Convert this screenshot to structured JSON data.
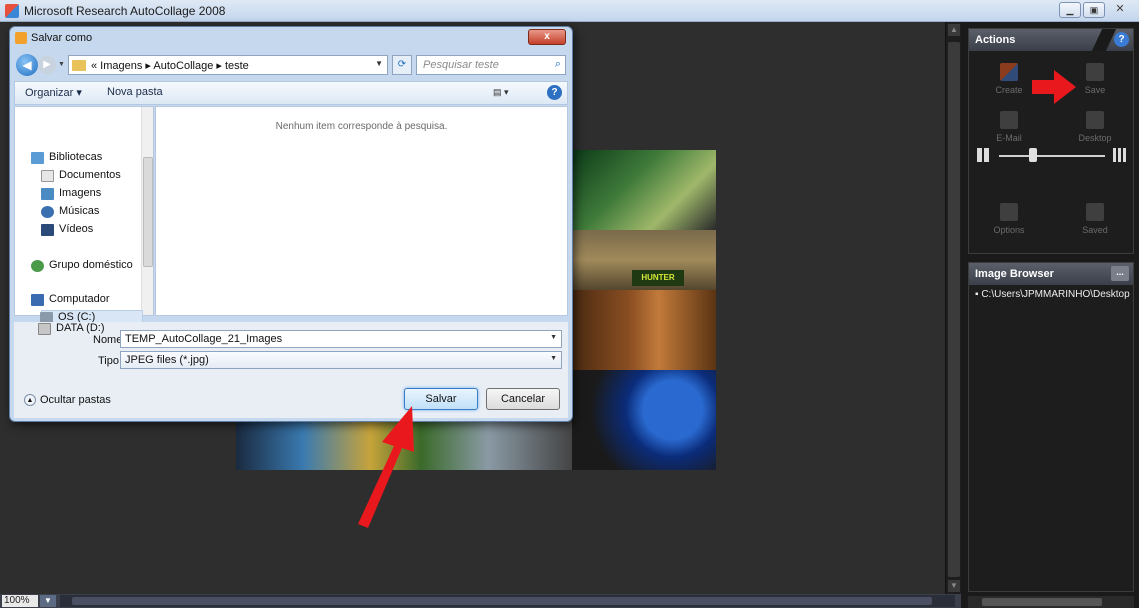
{
  "app": {
    "title": "Microsoft Research AutoCollage 2008",
    "zoom": "100%"
  },
  "collage": {
    "logo_text": "HUNTER"
  },
  "dialog": {
    "title": "Salvar como",
    "close_label": "x",
    "address_path": "« Imagens ▸ AutoCollage ▸ teste",
    "search_placeholder": "Pesquisar teste",
    "toolbar": {
      "organize": "Organizar ▾",
      "new_folder": "Nova pasta"
    },
    "sidebar": [
      {
        "label": "Bibliotecas",
        "icon": "library-icon"
      },
      {
        "label": "Documentos",
        "icon": "documents-icon"
      },
      {
        "label": "Imagens",
        "icon": "pictures-icon"
      },
      {
        "label": "Músicas",
        "icon": "music-icon"
      },
      {
        "label": "Vídeos",
        "icon": "videos-icon"
      },
      {
        "label": "Grupo doméstico",
        "icon": "homegroup-icon"
      },
      {
        "label": "Computador",
        "icon": "computer-icon"
      },
      {
        "label": "OS (C:)",
        "icon": "drive-icon"
      },
      {
        "label": "DATA (D:)",
        "icon": "drive-icon"
      }
    ],
    "empty_message": "Nenhum item corresponde à pesquisa.",
    "filename_label": "Nome:",
    "filename_value": "TEMP_AutoCollage_21_Images",
    "filetype_label": "Tipo:",
    "filetype_value": "JPEG files (*.jpg)",
    "hide_folders": "Ocultar pastas",
    "save_button": "Salvar",
    "cancel_button": "Cancelar"
  },
  "right_panel": {
    "actions_title": "Actions",
    "actions": [
      {
        "label": "Create",
        "icon": "create-icon"
      },
      {
        "label": "Save",
        "icon": "save-icon"
      },
      {
        "label": "E-Mail",
        "icon": "email-icon"
      },
      {
        "label": "Desktop",
        "icon": "desktop-icon"
      },
      {
        "label": "Options",
        "icon": "options-icon"
      },
      {
        "label": "Saved",
        "icon": "folder-icon"
      }
    ],
    "image_browser_title": "Image Browser",
    "image_browser_button": "...",
    "image_browser_path": "C:\\Users\\JPMMARINHO\\Desktop"
  },
  "colors": {
    "annotation_arrow": "#e8181c",
    "panel_bg": "#1a1a1a"
  }
}
